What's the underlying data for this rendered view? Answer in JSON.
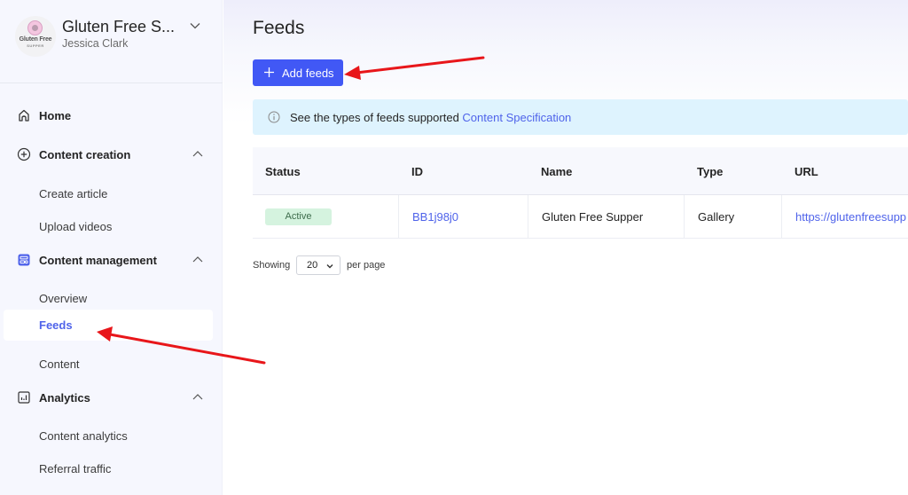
{
  "account": {
    "name": "Gluten Free S...",
    "user": "Jessica Clark",
    "logo_line1": "Gluten Free",
    "logo_line2": "SUPPER"
  },
  "sidebar": {
    "home": {
      "label": "Home",
      "icon": "home-icon"
    },
    "sections": [
      {
        "label": "Content creation",
        "icon": "plus-circle-icon",
        "expanded": true,
        "items": [
          {
            "label": "Create article"
          },
          {
            "label": "Upload videos"
          }
        ]
      },
      {
        "label": "Content management",
        "icon": "content-management-icon",
        "expanded": true,
        "items": [
          {
            "label": "Overview"
          },
          {
            "label": "Feeds",
            "active": true
          },
          {
            "label": "Content"
          }
        ]
      },
      {
        "label": "Analytics",
        "icon": "chart-icon",
        "expanded": true,
        "items": [
          {
            "label": "Content analytics"
          },
          {
            "label": "Referral traffic"
          }
        ]
      }
    ]
  },
  "main": {
    "title": "Feeds",
    "add_button": "Add feeds",
    "info": {
      "text": "See the types of feeds supported ",
      "link": "Content Specification"
    },
    "table": {
      "columns": [
        "Status",
        "ID",
        "Name",
        "Type",
        "URL"
      ],
      "rows": [
        {
          "status": "Active",
          "id": "BB1j98j0",
          "name": "Gluten Free Supper",
          "type": "Gallery",
          "url": "https://glutenfreesupp"
        }
      ]
    },
    "pager": {
      "showing_label": "Showing",
      "per_page_value": "20",
      "per_page_label": "per page"
    }
  },
  "colors": {
    "accent": "#4158f5",
    "link": "#4f63ea",
    "active_badge_bg": "#d5f3df",
    "info_bg": "#def3fe",
    "annotation_arrow": "#e8161a"
  }
}
